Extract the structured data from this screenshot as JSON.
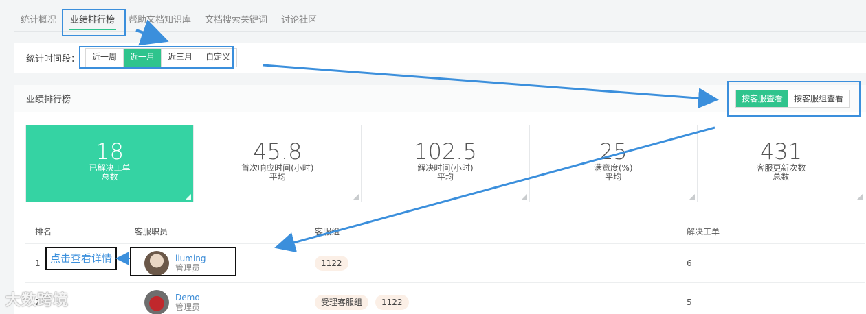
{
  "top_tabs": [
    "统计概况",
    "业绩排行榜",
    "帮助文档知识库",
    "文档搜索关键词",
    "讨论社区"
  ],
  "period": {
    "label": "统计时间段：",
    "options": [
      "近一周",
      "近一月",
      "近三月",
      "自定义"
    ],
    "selected": "近一月"
  },
  "panel": {
    "title": "业绩排行榜",
    "view_by_agent": "按客服查看",
    "view_by_group": "按客服组查看"
  },
  "stats": [
    {
      "value": "18",
      "label": "已解决工单",
      "sub": "总数"
    },
    {
      "value": "45.8",
      "label": "首次响应时间(小时)",
      "sub": "平均"
    },
    {
      "value": "102.5",
      "label": "解决时间(小时)",
      "sub": "平均"
    },
    {
      "value": "25",
      "label": "满意度(%)",
      "sub": "平均"
    },
    {
      "value": "431",
      "label": "客服更新次数",
      "sub": "总数"
    }
  ],
  "table": {
    "headers": [
      "排名",
      "客服职员",
      "客服组",
      "解决工单"
    ],
    "rows": [
      {
        "rank": "1",
        "name": "liuming",
        "role": "管理员",
        "groups": [
          "1122"
        ],
        "solved": "6"
      },
      {
        "rank": "2",
        "name": "Demo",
        "role": "管理员",
        "groups": [
          "受理客服组",
          "1122"
        ],
        "solved": "5"
      }
    ]
  },
  "annotation": {
    "click_detail": "点击查看详情"
  },
  "watermark": "大数跨境",
  "colors": {
    "accent": "#2fc48d",
    "annotation": "#3b8fdc"
  }
}
